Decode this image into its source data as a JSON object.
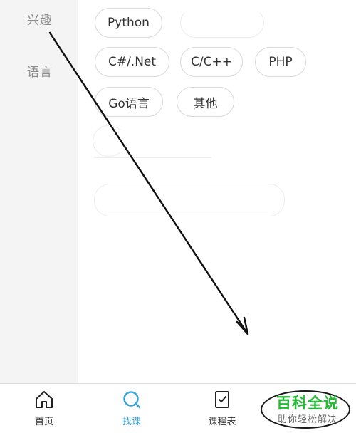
{
  "sidebar": {
    "items": [
      {
        "label": "兴趣"
      },
      {
        "label": "语言"
      }
    ]
  },
  "chips": [
    {
      "label": "Python"
    },
    {
      "label": "C#/.Net"
    },
    {
      "label": "C/C++"
    },
    {
      "label": "PHP"
    },
    {
      "label": "Go语言"
    },
    {
      "label": "其他"
    }
  ],
  "tabbar": {
    "tabs": [
      {
        "label": "首页",
        "icon": "home-icon"
      },
      {
        "label": "找课",
        "icon": "search-icon",
        "active": true
      },
      {
        "label": "课程表",
        "icon": "schedule-icon"
      }
    ]
  },
  "watermark": {
    "title": "百科全说",
    "subtitle": "助你轻松解决"
  },
  "colors": {
    "accent": "#3aa6d8",
    "watermark_green": "#22bb33",
    "sidebar_bg": "#f4f4f4"
  }
}
